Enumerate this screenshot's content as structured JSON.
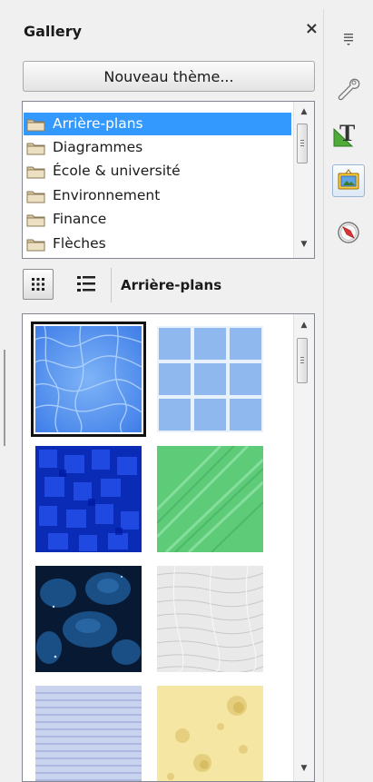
{
  "deck": {
    "title": "Gallery",
    "close_label": "×"
  },
  "new_theme_button": "Nouveau thème...",
  "themes": [
    {
      "label": "Arrière-plans",
      "selected": true
    },
    {
      "label": "Diagrammes",
      "selected": false
    },
    {
      "label": "École & université",
      "selected": false
    },
    {
      "label": "Environnement",
      "selected": false
    },
    {
      "label": "Finance",
      "selected": false
    },
    {
      "label": "Flèches",
      "selected": false
    }
  ],
  "view": {
    "icon_view_icon": "grid-icon",
    "detail_view_icon": "list-icon",
    "current_theme": "Arrière-plans"
  },
  "gallery_items": [
    {
      "icon": "water-texture",
      "selected": true
    },
    {
      "icon": "blue-tiles-texture",
      "selected": false
    },
    {
      "icon": "blue-mosaic-texture",
      "selected": false
    },
    {
      "icon": "green-marble-texture",
      "selected": false
    },
    {
      "icon": "dark-blue-bubbles-texture",
      "selected": false
    },
    {
      "icon": "white-paper-texture",
      "selected": false
    },
    {
      "icon": "blue-fabric-texture",
      "selected": false
    },
    {
      "icon": "cheese-texture",
      "selected": false
    }
  ],
  "tabbar": [
    {
      "icon": "hamburger-menu-icon",
      "active": false
    },
    {
      "icon": "wrench-icon",
      "active": false
    },
    {
      "icon": "styles-icon",
      "active": false
    },
    {
      "icon": "gallery-icon",
      "active": true
    },
    {
      "icon": "navigator-icon",
      "active": false
    }
  ],
  "colors": {
    "selection": "#3399ff",
    "background": "#f0f0f0",
    "border": "#828790"
  }
}
